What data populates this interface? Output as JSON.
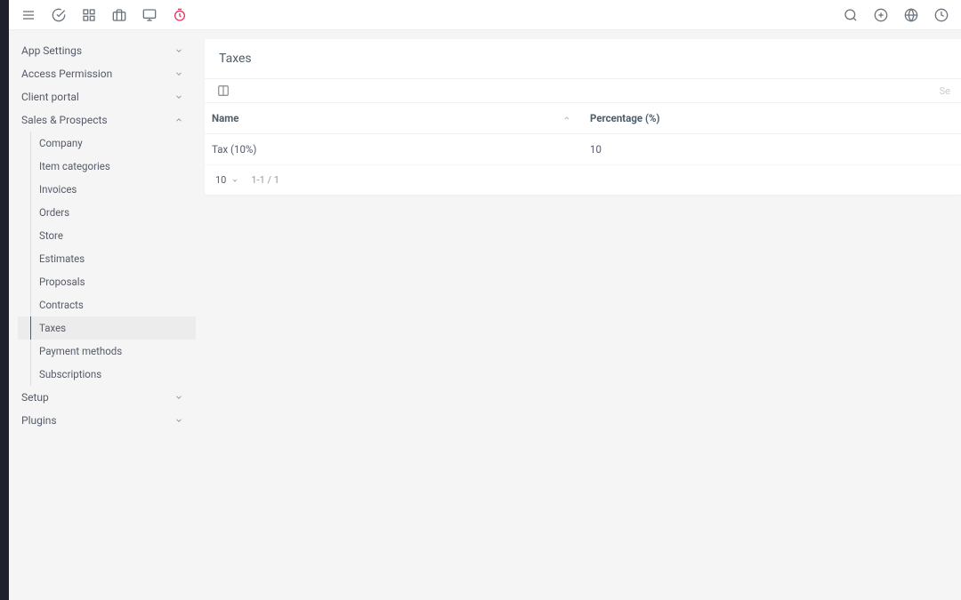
{
  "topbar": {
    "left_icons": [
      "menu",
      "check",
      "grid",
      "briefcase",
      "monitor",
      "timer"
    ],
    "right_icons": [
      "search",
      "plus",
      "globe",
      "clock"
    ]
  },
  "sidebar": {
    "sections": [
      {
        "label": "App Settings",
        "expanded": false
      },
      {
        "label": "Access Permission",
        "expanded": false
      },
      {
        "label": "Client portal",
        "expanded": false
      },
      {
        "label": "Sales & Prospects",
        "expanded": true,
        "items": [
          {
            "label": "Company"
          },
          {
            "label": "Item categories"
          },
          {
            "label": "Invoices"
          },
          {
            "label": "Orders"
          },
          {
            "label": "Store"
          },
          {
            "label": "Estimates"
          },
          {
            "label": "Proposals"
          },
          {
            "label": "Contracts"
          },
          {
            "label": "Taxes",
            "active": true
          },
          {
            "label": "Payment methods"
          },
          {
            "label": "Subscriptions"
          }
        ]
      },
      {
        "label": "Setup",
        "expanded": false
      },
      {
        "label": "Plugins",
        "expanded": false
      }
    ]
  },
  "page": {
    "title": "Taxes",
    "search_hint": "Se"
  },
  "table": {
    "columns": [
      {
        "label": "Name",
        "sorted": "asc"
      },
      {
        "label": "Percentage (%)"
      }
    ],
    "rows": [
      {
        "name": "Tax (10%)",
        "percentage": "10"
      }
    ]
  },
  "pager": {
    "per_page": "10",
    "range": "1-1 / 1"
  }
}
